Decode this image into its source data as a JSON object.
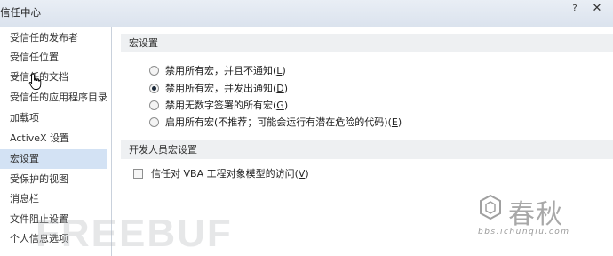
{
  "window": {
    "title": "信任中心",
    "help_glyph": "?",
    "close_glyph": "✕"
  },
  "nav": {
    "items": [
      {
        "label": "受信任的发布者",
        "active": false
      },
      {
        "label": "受信任位置",
        "active": false
      },
      {
        "label": "受信任的文档",
        "active": false
      },
      {
        "label": "受信任的应用程序目录",
        "active": false
      },
      {
        "label": "加载项",
        "active": false
      },
      {
        "label": "ActiveX 设置",
        "active": false
      },
      {
        "label": "宏设置",
        "active": true
      },
      {
        "label": "受保护的视图",
        "active": false
      },
      {
        "label": "消息栏",
        "active": false
      },
      {
        "label": "文件阻止设置",
        "active": false
      },
      {
        "label": "个人信息选项",
        "active": false
      }
    ]
  },
  "macro_settings": {
    "header": "宏设置",
    "options": [
      {
        "label": "禁用所有宏，并且不通知(",
        "hotkey": "L",
        "suffix": ")",
        "checked": false
      },
      {
        "label": "禁用所有宏，并发出通知(",
        "hotkey": "D",
        "suffix": ")",
        "checked": true
      },
      {
        "label": "禁用无数字签署的所有宏(",
        "hotkey": "G",
        "suffix": ")",
        "checked": false
      },
      {
        "label": "启用所有宏(不推荐；可能会运行有潜在危险的代码)(",
        "hotkey": "E",
        "suffix": ")",
        "checked": false
      }
    ]
  },
  "developer_settings": {
    "header": "开发人员宏设置",
    "checkbox_label": "信任对 VBA 工程对象模型的访问(",
    "checkbox_hotkey": "V",
    "checkbox_suffix": ")",
    "checked": false
  },
  "watermarks": {
    "left_text": "FREEBUF",
    "right_text": "春秋",
    "right_sub_text": "bbs.ichunqiu.com"
  },
  "colors": {
    "active_nav_bg": "#d3e2f4",
    "section_header_bg": "#eef0f2",
    "titlebar_bg": "#dbe3ee"
  }
}
